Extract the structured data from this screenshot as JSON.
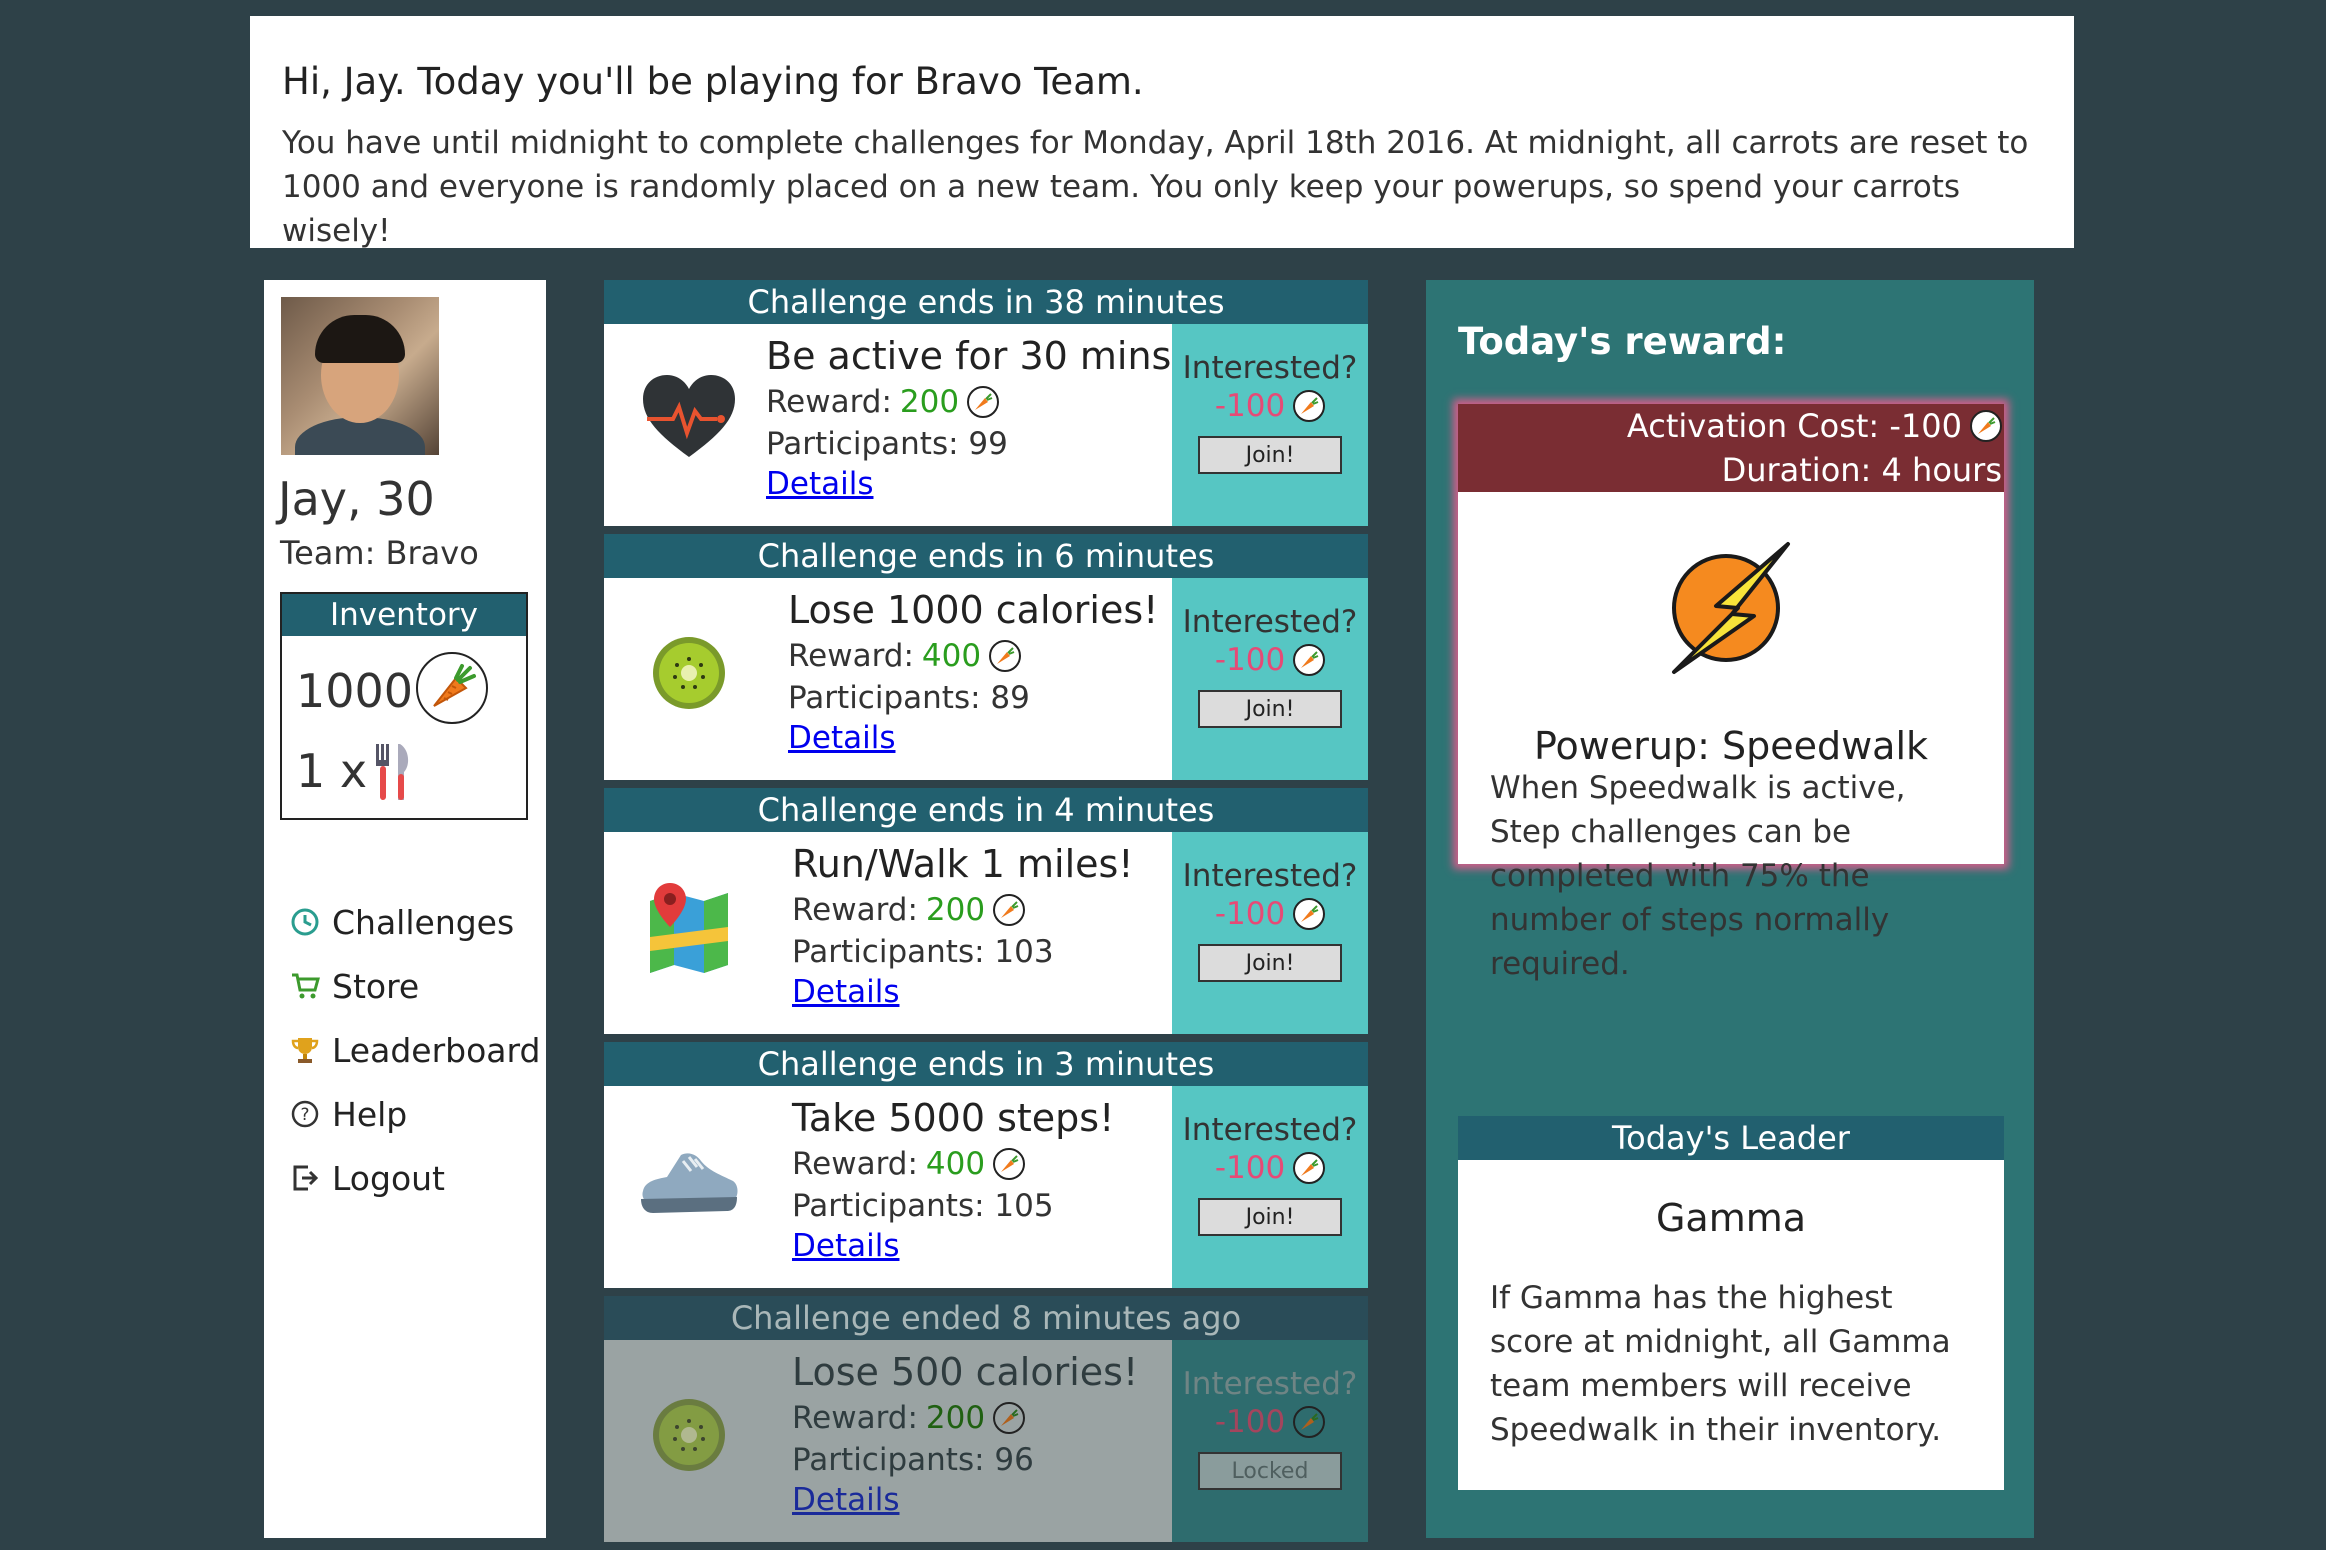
{
  "banner": {
    "greeting": "Hi, Jay. Today you'll be playing for Bravo Team.",
    "message": "You have until midnight to complete challenges for Monday, April 18th 2016. At midnight, all carrots are reset to 1000 and everyone is randomly placed on a new team. You only keep your powerups, so spend your carrots wisely!"
  },
  "profile": {
    "name_age": "Jay, 30",
    "team": "Team: Bravo",
    "inventory_title": "Inventory",
    "carrots": "1000",
    "cutlery_count": "1 x"
  },
  "nav": [
    {
      "label": "Challenges",
      "icon": "clock-icon"
    },
    {
      "label": "Store",
      "icon": "cart-icon"
    },
    {
      "label": "Leaderboard",
      "icon": "trophy-icon"
    },
    {
      "label": "Help",
      "icon": "help-icon"
    },
    {
      "label": "Logout",
      "icon": "logout-icon"
    }
  ],
  "challenges": [
    {
      "header": "Challenge ends in 38 minutes",
      "title": "Be active for 30 mins!",
      "reward_label": "Reward:",
      "reward": "200",
      "participants": "Participants: 99",
      "details": "Details",
      "interested": "Interested?",
      "cost": "-100",
      "button": "Join!",
      "icon": "heart-rate-icon",
      "locked": false
    },
    {
      "header": "Challenge ends in 6 minutes",
      "title": "Lose 1000 calories!",
      "reward_label": "Reward:",
      "reward": "400",
      "participants": "Participants: 89",
      "details": "Details",
      "interested": "Interested?",
      "cost": "-100",
      "button": "Join!",
      "icon": "kiwi-icon",
      "locked": false
    },
    {
      "header": "Challenge ends in 4 minutes",
      "title": "Run/Walk 1 miles!",
      "reward_label": "Reward:",
      "reward": "200",
      "participants": "Participants: 103",
      "details": "Details",
      "interested": "Interested?",
      "cost": "-100",
      "button": "Join!",
      "icon": "map-icon",
      "locked": false
    },
    {
      "header": "Challenge ends in 3 minutes",
      "title": "Take 5000 steps!",
      "reward_label": "Reward:",
      "reward": "400",
      "participants": "Participants: 105",
      "details": "Details",
      "interested": "Interested?",
      "cost": "-100",
      "button": "Join!",
      "icon": "sneaker-icon",
      "locked": false
    },
    {
      "header": "Challenge ended 8 minutes ago",
      "title": "Lose 500 calories!",
      "reward_label": "Reward:",
      "reward": "200",
      "participants": "Participants: 96",
      "details": "Details",
      "interested": "Interested?",
      "cost": "-100",
      "button": "Locked",
      "icon": "kiwi-icon",
      "locked": true
    }
  ],
  "reward": {
    "heading": "Today's reward:",
    "activation": "Activation Cost: -100",
    "duration": "Duration: 4 hours",
    "powerup": "Powerup: Speedwalk",
    "description": "When Speedwalk is active, Step challenges can be completed with 75% the number of steps normally required."
  },
  "leader": {
    "heading": "Today's Leader",
    "team": "Gamma",
    "description": "If Gamma has the highest score at midnight, all Gamma team members will receive Speedwalk in their inventory."
  },
  "colors": {
    "background": "#2e4148",
    "teal_header": "#22606f",
    "join_panel": "#56c6c3",
    "reward_green": "#2a9d1e",
    "cost_pink": "#e64a76",
    "reward_head": "#7a2d33"
  }
}
